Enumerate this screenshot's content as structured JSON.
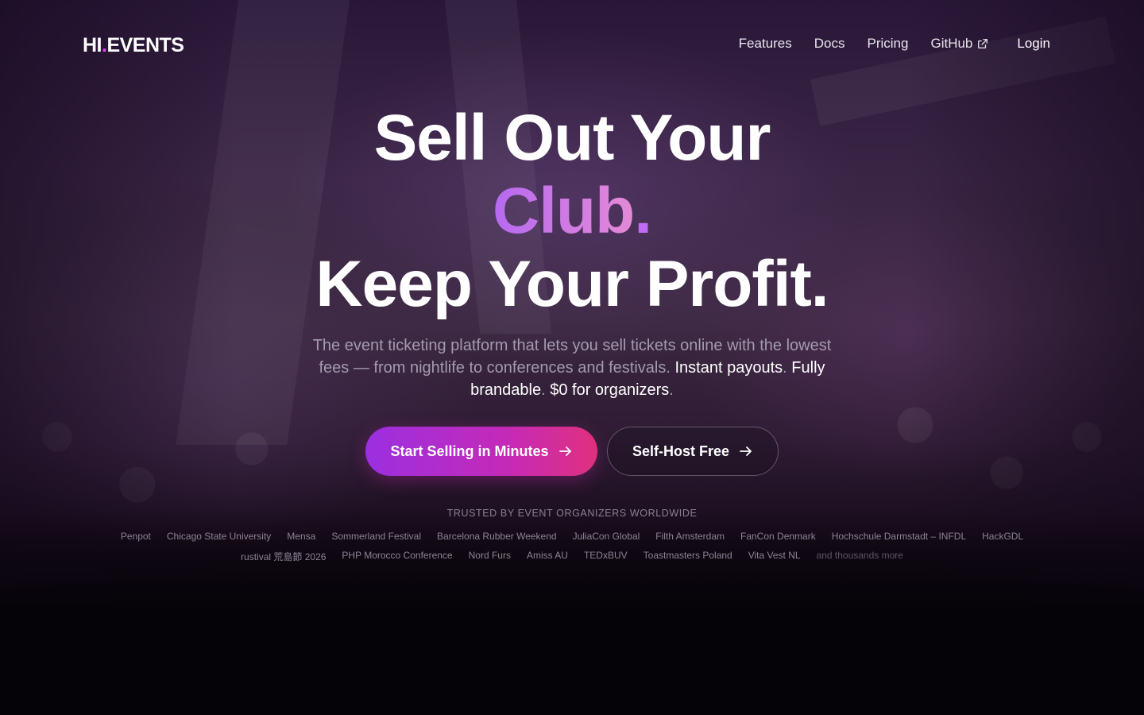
{
  "brand": {
    "left": "HI",
    "dot": ".",
    "right": "EVENTS"
  },
  "nav": {
    "items": [
      {
        "label": "Features"
      },
      {
        "label": "Docs"
      },
      {
        "label": "Pricing"
      },
      {
        "label": "GitHub",
        "icon": "external-link-icon"
      }
    ],
    "login": "Login"
  },
  "hero": {
    "line1": "Sell Out Your",
    "line2_word": "Club",
    "line2_dot": ".",
    "line3": "Keep Your Profit.",
    "subtitle_main": "The event ticketing platform that lets you sell tickets online with the lowest fees — from nightlife to conferences and festivals.",
    "subtitle_hl1": "Instant payouts",
    "subtitle_sep1": ".",
    "subtitle_hl2": "Fully brandable",
    "subtitle_sep2": ".",
    "subtitle_hl3": "$0 for organizers",
    "subtitle_end": "."
  },
  "cta": {
    "primary": "Start Selling in Minutes",
    "secondary": "Self-Host Free",
    "icon": "arrow-right-icon"
  },
  "trusted": {
    "heading": "TRUSTED BY EVENT ORGANIZERS WORLDWIDE",
    "row1": [
      "Penpot",
      "Chicago State University",
      "Mensa",
      "Sommerland Festival",
      "Barcelona Rubber Weekend",
      "JuliaCon Global",
      "Filth Amsterdam",
      "FanCon Denmark",
      "Hochschule Darmstadt – INFDL",
      "HackGDL"
    ],
    "row2": [
      "rustival 荒島節 2026",
      "PHP Morocco Conference",
      "Nord Furs",
      "Amiss AU",
      "TEDxBUV",
      "Toastmasters Poland",
      "Vita Vest NL"
    ],
    "more": "and thousands more"
  },
  "colors": {
    "accent": "#d946ef",
    "gradient_start": "#9b2fe0",
    "gradient_end": "#e0307e",
    "background": "#050308"
  }
}
